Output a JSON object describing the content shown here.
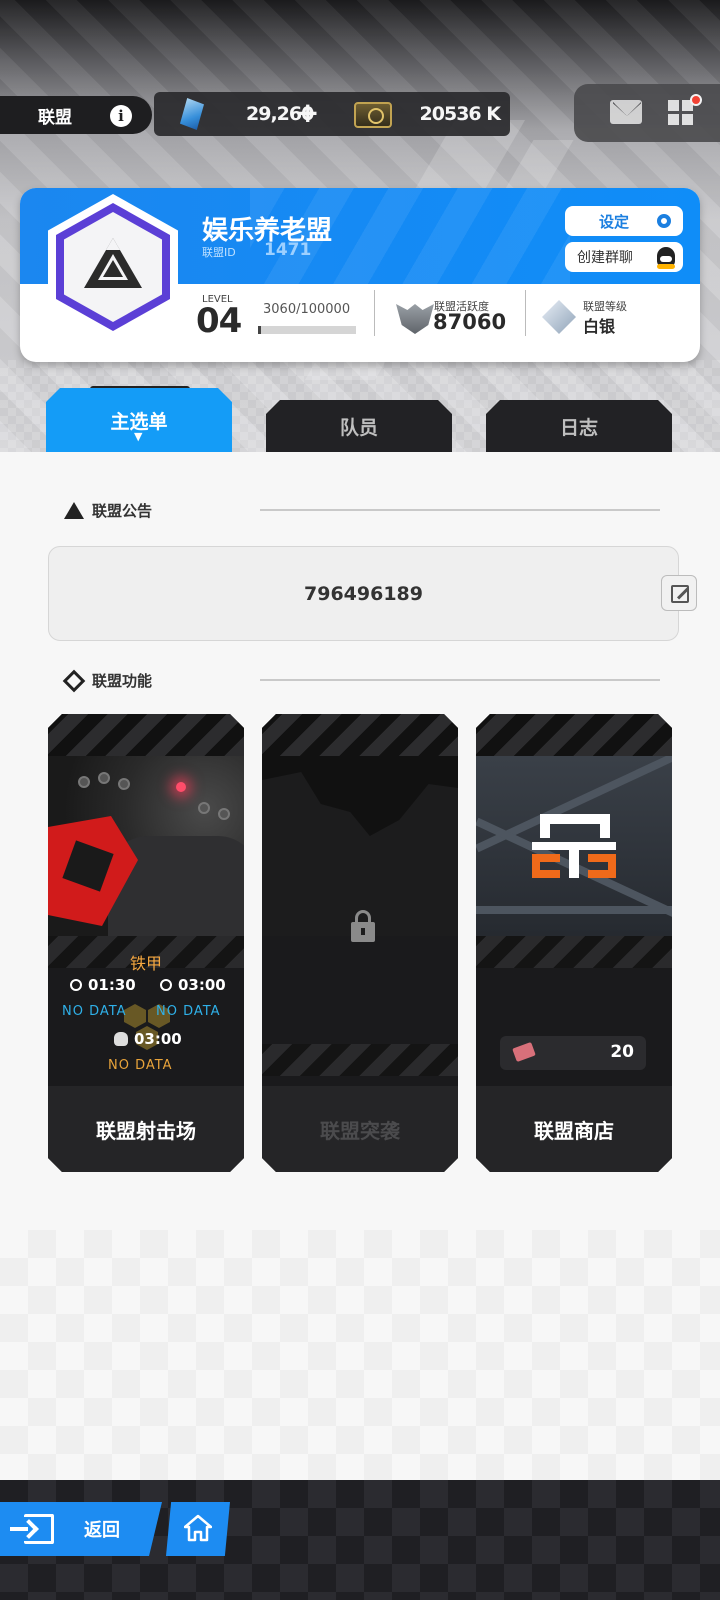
{
  "resources": {
    "alliance_tab_label": "联盟",
    "info_glyph": "i",
    "gem_value": "29,260",
    "plus_glyph": "+",
    "coin_value": "20536 K"
  },
  "alliance": {
    "name": "娱乐养老盟",
    "id_label": "联盟ID",
    "id": "1471",
    "settings_label": "设定",
    "group_chat_label": "创建群聊",
    "level_label": "LEVEL",
    "level": "04",
    "exp_text": "3060/100000",
    "exp_progress": 0.0306,
    "activity_label": "联盟活跃度",
    "activity_value": "87060",
    "rank_label": "联盟等级",
    "rank_value": "白银"
  },
  "tabs": [
    {
      "label": "主选单",
      "active": true
    },
    {
      "label": "队员",
      "active": false
    },
    {
      "label": "日志",
      "active": false
    }
  ],
  "tab_arrow": "▼",
  "notice": {
    "section_title": "联盟公告",
    "content": "796496189"
  },
  "features": {
    "section_title": "联盟功能",
    "cards": [
      {
        "label": "联盟射击场",
        "sub_title": "铁甲",
        "timer_left": "01:30",
        "timer_right": "03:00",
        "nodata_left": "NO DATA",
        "nodata_right": "NO DATA",
        "boss_timer": "03:00",
        "boss_nodata": "NO DATA"
      },
      {
        "label": "联盟突袭",
        "locked": true
      },
      {
        "label": "联盟商店",
        "currency_value": "20"
      }
    ]
  },
  "bottom": {
    "back_label": "返回"
  },
  "colors": {
    "accent_blue": "#149cf7",
    "header_blue": "#1b87f0",
    "emblem_purple": "#5b3fd6",
    "shop_orange": "#f06a1a",
    "nodata_blue": "#2fb0e8",
    "nodata_orange": "#e8a33a"
  },
  "icons": [
    "info-icon",
    "gem-icon",
    "plus-icon",
    "coin-icon",
    "mail-icon",
    "grid-menu-icon",
    "notification-dot",
    "gear-icon",
    "qq-icon",
    "alliance-emblem-icon",
    "activity-icon",
    "rank-icon",
    "warning-icon",
    "diamond-icon",
    "edit-icon",
    "clock-icon",
    "skull-icon",
    "lock-icon",
    "shop-logo-icon",
    "ticket-icon",
    "exit-icon",
    "home-icon"
  ]
}
